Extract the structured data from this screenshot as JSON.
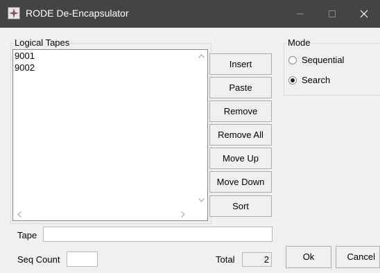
{
  "window": {
    "title": "RODE De-Encapsulator",
    "icon": "rode-app-icon",
    "controls": [
      "minimize-icon",
      "maximize-icon",
      "close-icon"
    ]
  },
  "tapes_group": {
    "legend": "Logical Tapes",
    "items": [
      "9001",
      "9002"
    ],
    "scroll_icons": [
      "chevron-up-icon",
      "chevron-down-icon",
      "chevron-left-icon",
      "chevron-right-icon"
    ]
  },
  "buttons": {
    "insert": "Insert",
    "paste": "Paste",
    "remove": "Remove",
    "remove_all": "Remove All",
    "move_up": "Move Up",
    "move_down": "Move Down",
    "sort": "Sort",
    "ok": "Ok",
    "cancel": "Cancel"
  },
  "mode_group": {
    "legend": "Mode",
    "options": [
      {
        "label": "Sequential",
        "selected": false
      },
      {
        "label": "Search",
        "selected": true
      }
    ]
  },
  "tape_field": {
    "label": "Tape",
    "value": ""
  },
  "seq_count": {
    "label": "Seq Count",
    "value": ""
  },
  "total": {
    "label": "Total",
    "value": "2"
  },
  "colors": {
    "titlebar": "#444444",
    "window_bg": "#f0f0f0",
    "button_border": "#adadad",
    "control_border": "#828790"
  }
}
